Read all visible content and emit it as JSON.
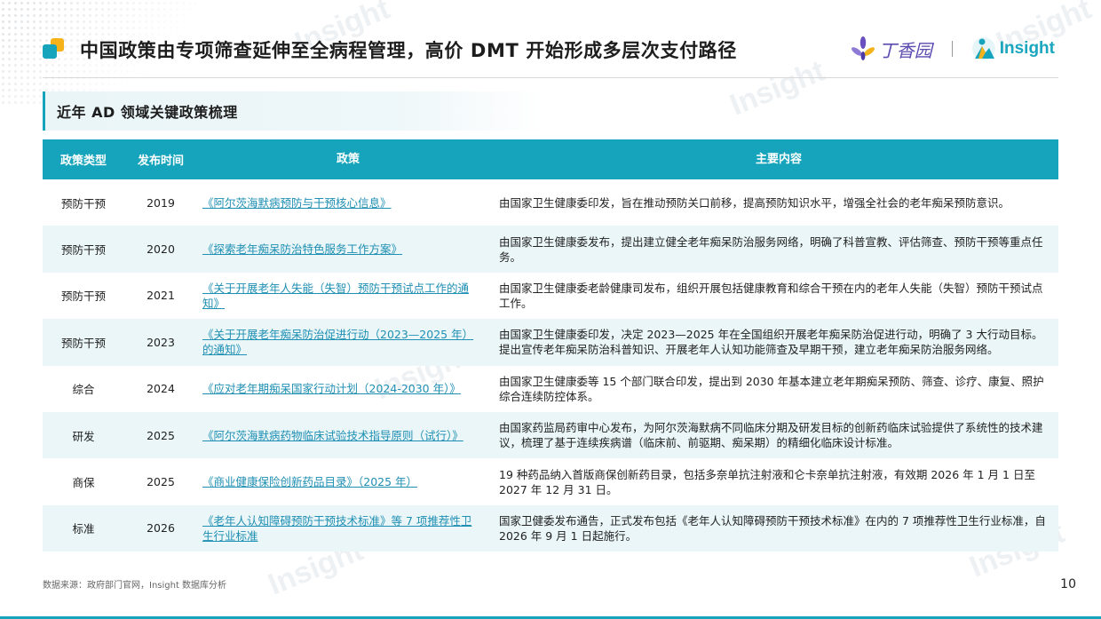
{
  "header": {
    "title": "中国政策由专项筛查延伸至全病程管理，高价 DMT 开始形成多层次支付路径",
    "brand_dxy": "丁香园",
    "brand_insight": "Insight"
  },
  "section": {
    "title": "近年 AD 领域关键政策梳理"
  },
  "table": {
    "headers": [
      "政策类型",
      "发布时间",
      "政策",
      "主要内容"
    ],
    "rows": [
      {
        "type": "预防干预",
        "year": "2019",
        "policy": "《阿尔茨海默病预防与干预核心信息》",
        "content": "由国家卫生健康委印发，旨在推动预防关口前移，提高预防知识水平，增强全社会的老年痴呆预防意识。"
      },
      {
        "type": "预防干预",
        "year": "2020",
        "policy": "《探索老年痴呆防治特色服务工作方案》",
        "content": "由国家卫生健康委发布，提出建立健全老年痴呆防治服务网络，明确了科普宣教、评估筛查、预防干预等重点任务。"
      },
      {
        "type": "预防干预",
        "year": "2021",
        "policy": "《关于开展老年人失能（失智）预防干预试点工作的通知》",
        "content": "由国家卫生健康委老龄健康司发布，组织开展包括健康教育和综合干预在内的老年人失能（失智）预防干预试点工作。"
      },
      {
        "type": "预防干预",
        "year": "2023",
        "policy": "《关于开展老年痴呆防治促进行动（2023—2025 年）的通知》",
        "content": "由国家卫生健康委印发，决定 2023—2025 年在全国组织开展老年痴呆防治促进行动，明确了 3 大行动目标。提出宣传老年痴呆防治科普知识、开展老年人认知功能筛查及早期干预，建立老年痴呆防治服务网络。"
      },
      {
        "type": "综合",
        "year": "2024",
        "policy": "《应对老年期痴呆国家行动计划（2024-2030 年）》",
        "content": "由国家卫生健康委等 15 个部门联合印发，提出到 2030 年基本建立老年期痴呆预防、筛查、诊疗、康复、照护综合连续防控体系。"
      },
      {
        "type": "研发",
        "year": "2025",
        "policy": "《阿尔茨海默病药物临床试验技术指导原则（试行）》",
        "content": "由国家药监局药审中心发布，为阿尔茨海默病不同临床分期及研发目标的创新药临床试验提供了系统性的技术建议，梳理了基于连续疾病谱（临床前、前驱期、痴呆期）的精细化临床设计标准。"
      },
      {
        "type": "商保",
        "year": "2025",
        "policy": "《商业健康保险创新药品目录》（2025 年）",
        "content": "19 种药品纳入首版商保创新药目录，包括多奈单抗注射液和仑卡奈单抗注射液，有效期 2026 年 1 月 1 日至 2027 年 12 月 31 日。"
      },
      {
        "type": "标准",
        "year": "2026",
        "policy": "《老年人认知障碍预防干预技术标准》等 7 项推荐性卫生行业标准",
        "content": "国家卫健委发布通告，正式发布包括《老年人认知障碍预防干预技术标准》在内的 7 项推荐性卫生行业标准，自 2026 年 9 月 1 日起施行。"
      }
    ]
  },
  "footer": {
    "source": "数据来源：政府部门官网，Insight 数据库分析",
    "page_number": "10"
  },
  "colors": {
    "accent": "#16a4bc",
    "accent_yellow": "#f5b21a",
    "row_alt": "#eaf6f8",
    "link": "#1f8fb3"
  }
}
